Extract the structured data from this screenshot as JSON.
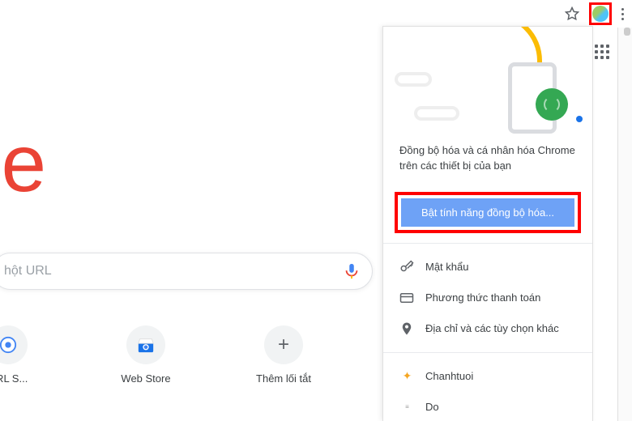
{
  "toolbar": {
    "star_name": "star-icon",
    "avatar_name": "profile-avatar",
    "menu_name": "kebab-menu"
  },
  "main": {
    "logo_text": "ogle",
    "search_placeholder": "hột URL",
    "shortcuts": [
      {
        "label": "URL S..."
      },
      {
        "label": "Web Store"
      },
      {
        "label": "Thêm lối tắt"
      }
    ]
  },
  "panel": {
    "description": "Đồng bộ hóa và cá nhân hóa Chrome trên các thiết bị của bạn",
    "sync_button": "Bật tính năng đồng bộ hóa...",
    "menu": [
      {
        "icon": "key-icon",
        "label": "Mật khẩu"
      },
      {
        "icon": "card-icon",
        "label": "Phương thức thanh toán"
      },
      {
        "icon": "pin-icon",
        "label": "Địa chỉ và các tùy chọn khác"
      }
    ],
    "others": [
      {
        "label": "Chanhtuoi"
      },
      {
        "label": "Do"
      }
    ]
  }
}
